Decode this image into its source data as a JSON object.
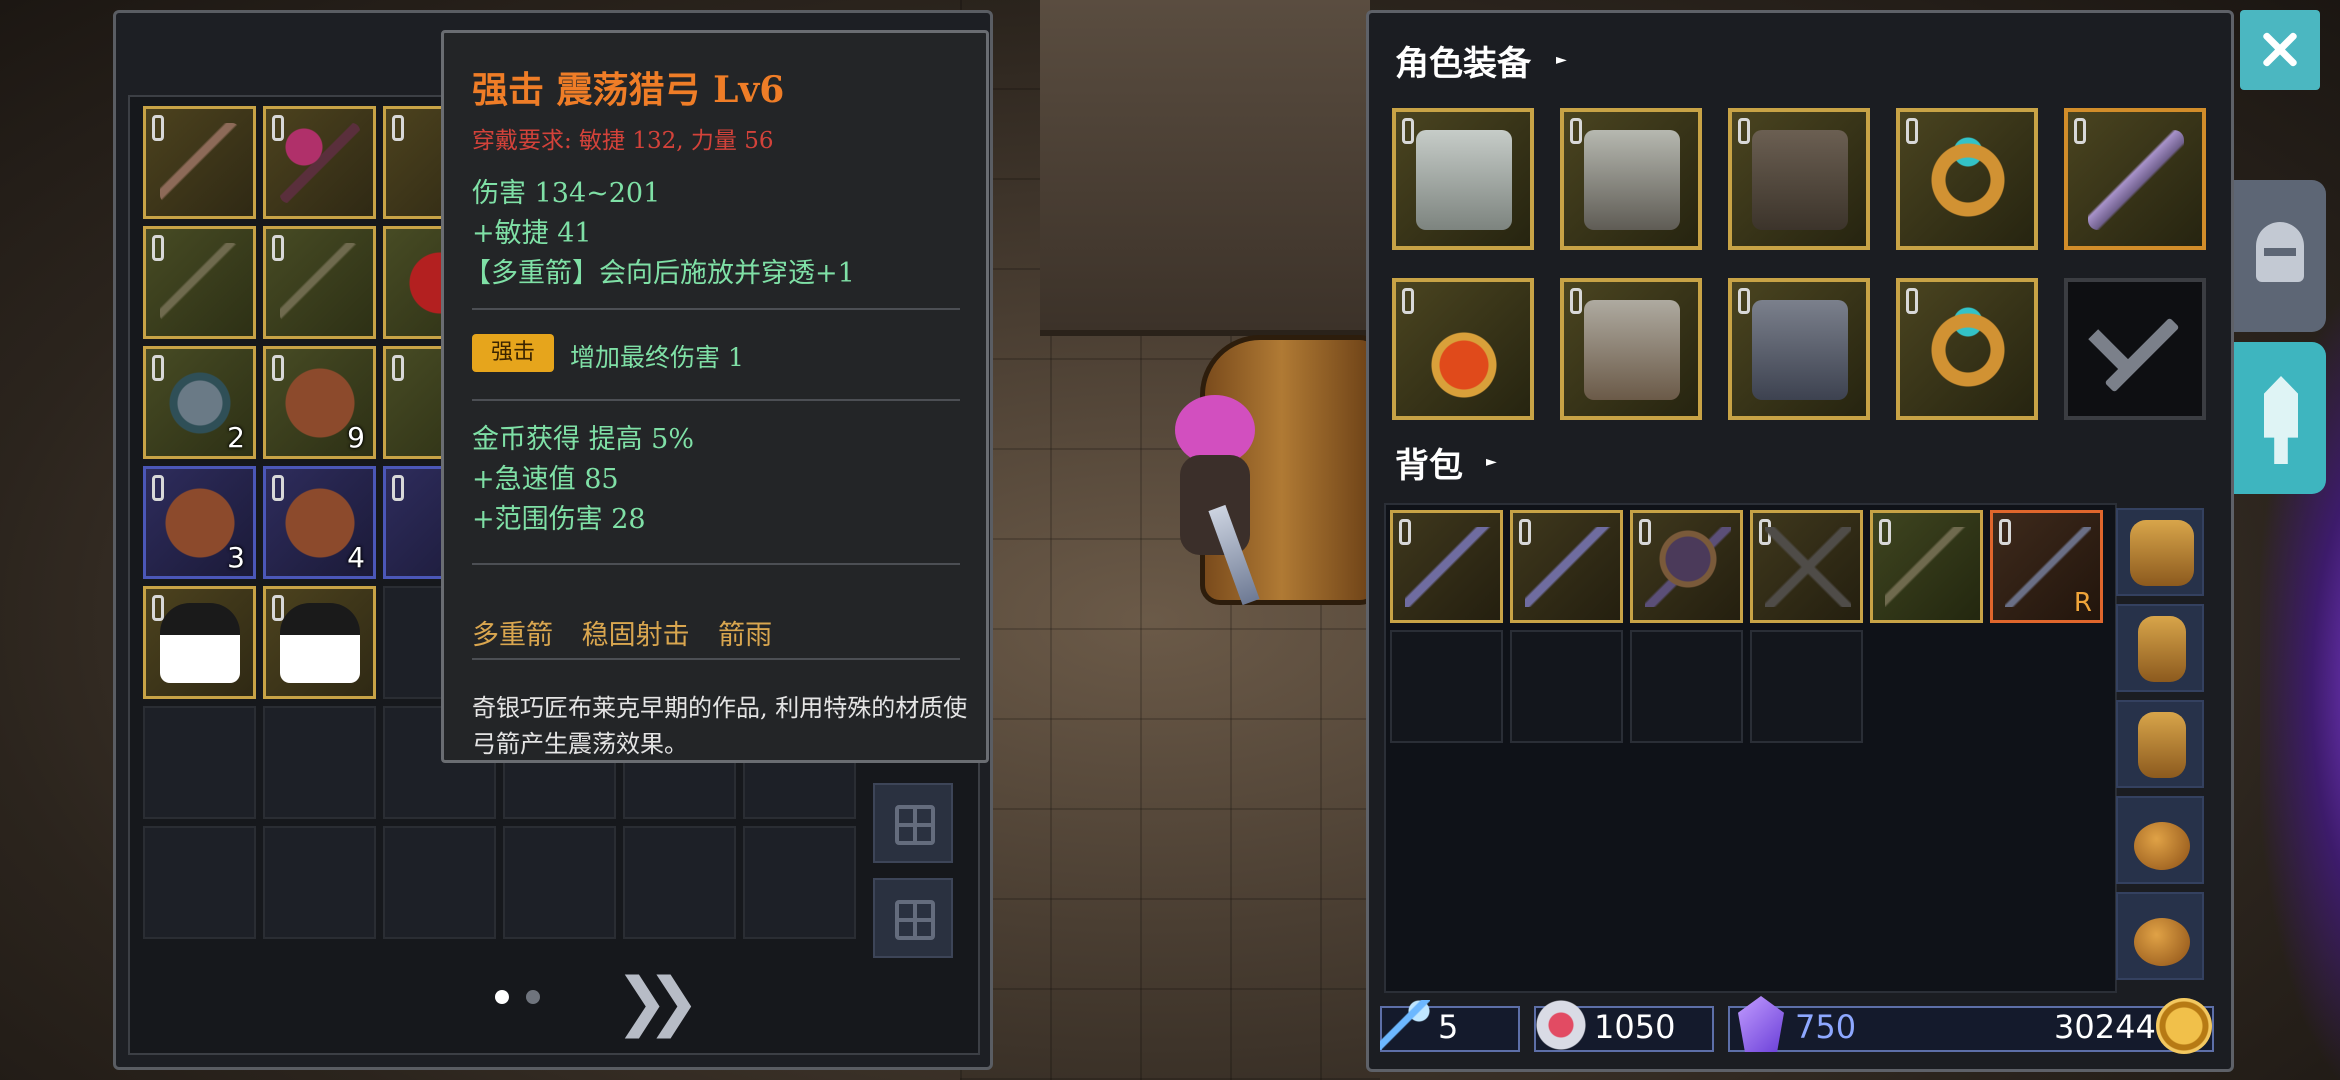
{
  "tooltip": {
    "title": "强击 震荡猎弓 Lv6",
    "requirement": "穿戴要求:  敏捷 132, 力量 56",
    "damage": "伤害   134~201",
    "agility": "+敏捷 41",
    "multishot": "【多重箭】会向后施放并穿透+1",
    "badge": "强击",
    "badge_effect": "增加最终伤害 1",
    "gold": "金币获得 提高 5%",
    "haste": "+急速值 85",
    "area": "+范围伤害 28",
    "skills": "多重箭 稳固射击 箭雨",
    "description": "奇银巧匠布莱克早期的作品, 利用特殊的材质使弓箭产生震荡效果。"
  },
  "inventory": {
    "counts": {
      "amulet": "2",
      "feather": "9",
      "brown1": "3",
      "brown2": "4"
    },
    "page_dots": 2,
    "active_page": 1
  },
  "equipment": {
    "title": "角色装备",
    "slots": [
      "helmet",
      "armor",
      "chest",
      "ring",
      "sword",
      "necklace",
      "gloves",
      "boots",
      "ring-2",
      "weapon-empty"
    ]
  },
  "bag": {
    "title": "背包",
    "rare_mark": "R"
  },
  "currency": {
    "wand": "5",
    "heart": "1050",
    "gem": "750",
    "coin": "30244"
  },
  "colors": {
    "accent": "#4bb7c1",
    "gold_border": "#c8a346",
    "title_orange": "#ef7d27",
    "stat_green": "#7fe0a6"
  }
}
